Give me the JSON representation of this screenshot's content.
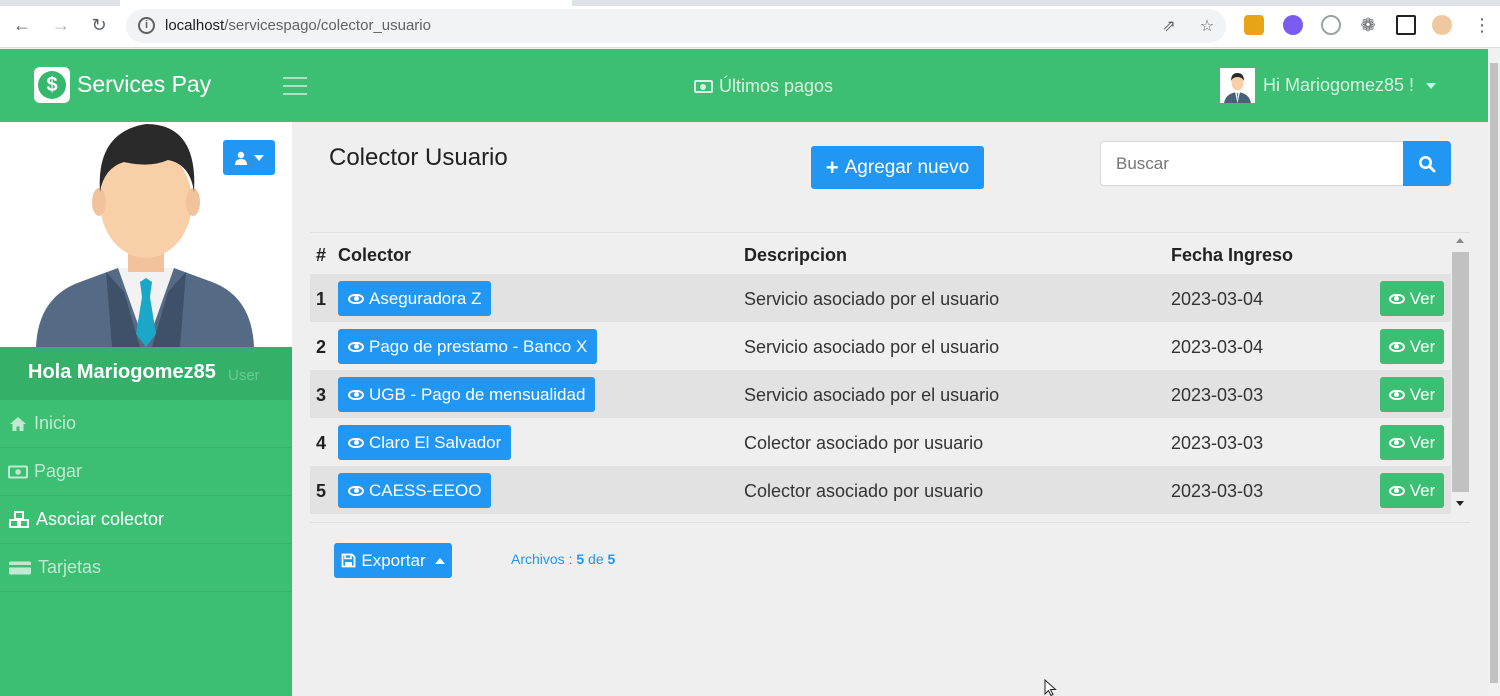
{
  "browser": {
    "url_host": "localhost",
    "url_path": "/servicespago/colector_usuario"
  },
  "header": {
    "brand": "Services Pay",
    "logo_symbol": "$",
    "ultimos_pagos": "Últimos pagos",
    "user_greeting": "Hi Mariogomez85 !"
  },
  "sidebar": {
    "greeting": "Hola Mariogomez85",
    "role": "User",
    "items": [
      {
        "label": "Inicio",
        "icon": "home-icon"
      },
      {
        "label": "Pagar",
        "icon": "money-icon"
      },
      {
        "label": "Asociar colector",
        "icon": "cubes-icon"
      },
      {
        "label": "Tarjetas",
        "icon": "credit-card-icon"
      }
    ]
  },
  "main": {
    "title": "Colector Usuario",
    "add_button": "Agregar nuevo",
    "search_placeholder": "Buscar",
    "table": {
      "headers": [
        "#",
        "Colector",
        "Descripcion",
        "Fecha Ingreso"
      ],
      "ver_label": "Ver",
      "rows": [
        {
          "num": "1",
          "colector": "Aseguradora Z",
          "descripcion": "Servicio asociado por el usuario",
          "fecha": "2023-03-04"
        },
        {
          "num": "2",
          "colector": "Pago de prestamo - Banco X",
          "descripcion": "Servicio asociado por el usuario",
          "fecha": "2023-03-04"
        },
        {
          "num": "3",
          "colector": "UGB - Pago de mensualidad",
          "descripcion": "Servicio asociado por el usuario",
          "fecha": "2023-03-03"
        },
        {
          "num": "4",
          "colector": "Claro El Salvador",
          "descripcion": "Colector asociado por usuario",
          "fecha": "2023-03-03"
        },
        {
          "num": "5",
          "colector": "CAESS-EEOO",
          "descripcion": "Colector asociado por usuario",
          "fecha": "2023-03-03"
        }
      ]
    },
    "export_button": "Exportar",
    "archivos": {
      "label": "Archivos :",
      "shown": "5",
      "of": "de",
      "total": "5"
    }
  },
  "colors": {
    "brand_green": "#3cbf73",
    "primary_blue": "#2196f3",
    "background": "#efefef"
  }
}
